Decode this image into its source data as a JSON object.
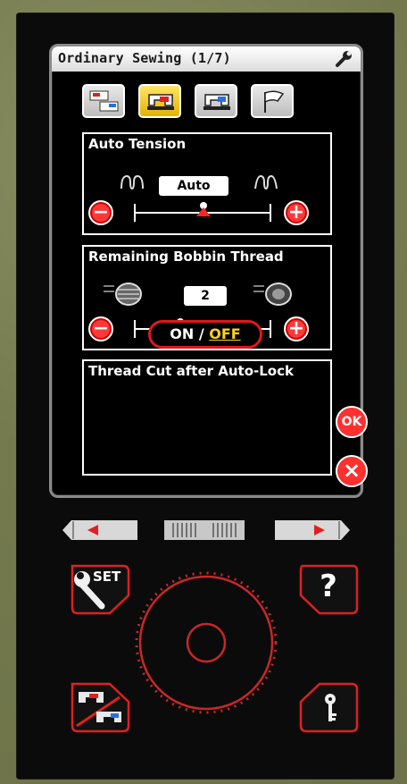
{
  "header": {
    "title": "Ordinary Sewing (1/7)",
    "settings_icon": "wrench-icon"
  },
  "modes": [
    {
      "name": "two-machines-mode",
      "icon": "sewing-machine-pair-icon",
      "active": false
    },
    {
      "name": "sewing-mode",
      "icon": "sewing-machine-icon",
      "active": true
    },
    {
      "name": "embroidery-mode",
      "icon": "embroidery-machine-icon",
      "active": false
    },
    {
      "name": "flag-mode",
      "icon": "flag-icon",
      "active": false
    }
  ],
  "auto_tension": {
    "title": "Auto Tension",
    "value": "Auto",
    "decrease": "−",
    "increase": "+",
    "level": 0.5
  },
  "bobbin": {
    "title": "Remaining Bobbin Thread",
    "value": "2",
    "decrease": "−",
    "increase": "+",
    "level": 0.33
  },
  "thread_cut": {
    "title": "Thread Cut after Auto-Lock",
    "on_label": "ON",
    "separator": " / ",
    "off_label": "OFF",
    "selected": "OFF"
  },
  "actions": {
    "ok": "OK",
    "cancel": "×"
  },
  "hardware": {
    "set_label": "SET",
    "help": "?"
  },
  "colors": {
    "accent": "#ff3030",
    "highlight": "#ffd21e",
    "panel": "#000000",
    "dial": "#c62828"
  }
}
